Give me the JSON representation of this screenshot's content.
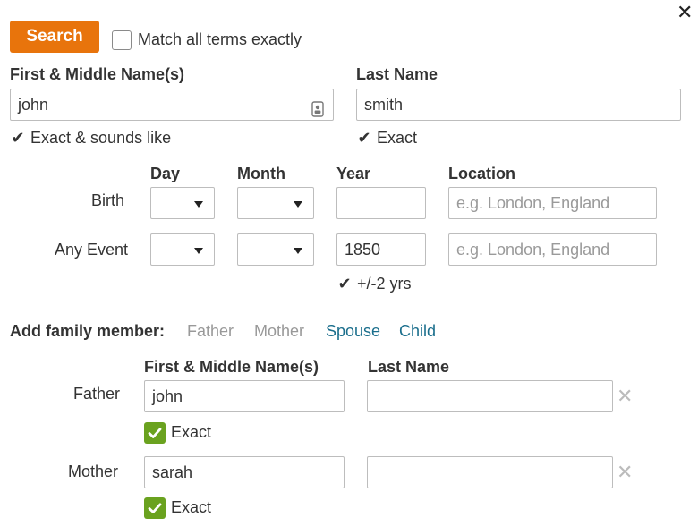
{
  "dialog": {
    "close_glyph": "✕"
  },
  "search": {
    "button_label": "Search",
    "match_exact_label": "Match all terms exactly",
    "match_exact_checked": false
  },
  "name": {
    "first_label": "First & Middle Name(s)",
    "first_value": "john",
    "first_option": "Exact & sounds like",
    "last_label": "Last Name",
    "last_value": "smith",
    "last_option": "Exact"
  },
  "events": {
    "col_day": "Day",
    "col_month": "Month",
    "col_year": "Year",
    "col_location": "Location",
    "birth": {
      "label": "Birth",
      "year": "",
      "location_placeholder": "e.g. London, England"
    },
    "any_event": {
      "label": "Any Event",
      "year": "1850",
      "location_placeholder": "e.g. London, England",
      "range_label": "+/-2 yrs"
    }
  },
  "family": {
    "add_label": "Add family member:",
    "options": [
      "Father",
      "Mother",
      "Spouse",
      "Child"
    ],
    "first_col_label": "First & Middle Name(s)",
    "last_col_label": "Last Name",
    "father": {
      "label": "Father",
      "first_value": "john",
      "last_value": "",
      "exact_label": "Exact",
      "exact_checked": true
    },
    "mother": {
      "label": "Mother",
      "first_value": "sarah",
      "last_value": "",
      "exact_label": "Exact",
      "exact_checked": true
    }
  },
  "colors": {
    "search_button": "#e8740c",
    "link_active": "#1a6e8c",
    "link_disabled": "#999999",
    "check_green": "#6aa21f"
  },
  "icons": {
    "close": "close-icon",
    "contact": "contact-card-icon",
    "check": "checkmark-icon",
    "remove": "remove-icon",
    "caret": "caret-down-icon"
  }
}
